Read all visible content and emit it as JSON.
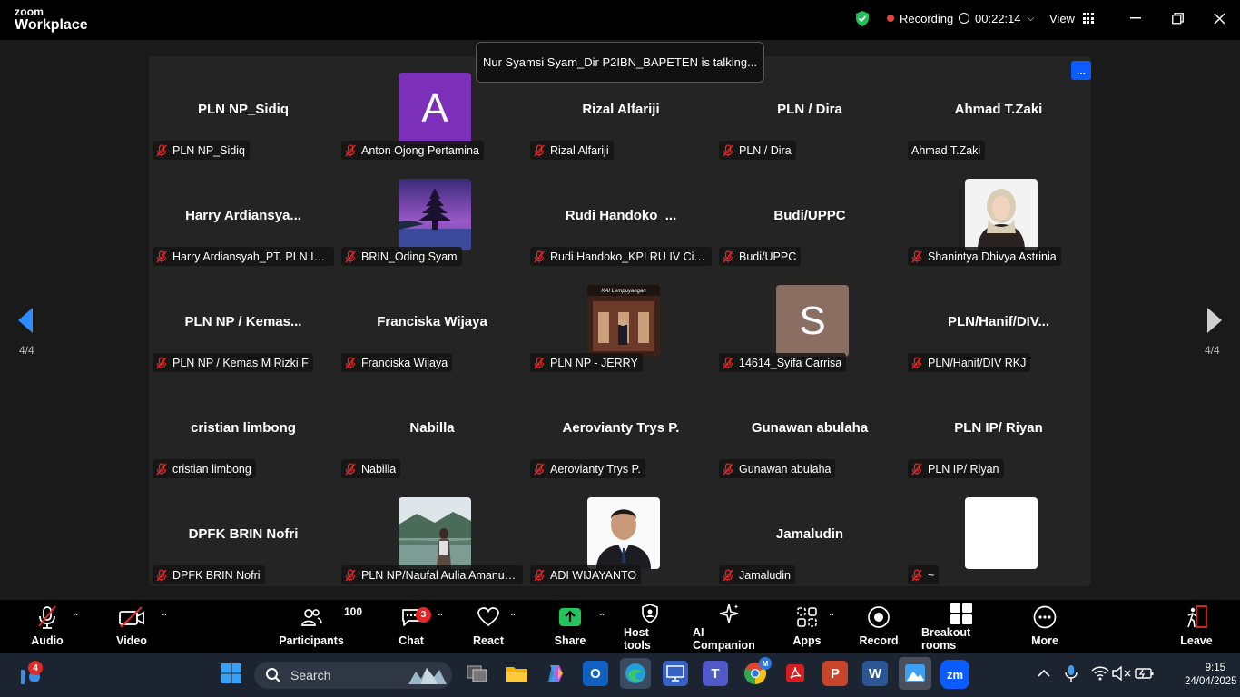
{
  "app": {
    "logo_top": "zoom",
    "logo_bottom": "Workplace"
  },
  "titlebar": {
    "recording_label": "Recording",
    "timer": "00:22:14",
    "view_label": "View"
  },
  "talking_banner": "Nur Syamsi Syam_Dir P2IBN_BAPETEN is talking...",
  "more_button_label": "...",
  "pagination": {
    "left": "4/4",
    "right": "4/4"
  },
  "participants": [
    {
      "display": "PLN NP_Sidiq",
      "label": "PLN NP_Sidiq",
      "muted": true,
      "avatar": "none"
    },
    {
      "display": "",
      "label": "Anton Ojong Pertamina",
      "muted": true,
      "avatar": "letter",
      "letter": "A",
      "color": "#7c2fb8"
    },
    {
      "display": "Rizal Alfariji",
      "label": "Rizal Alfariji",
      "muted": true,
      "avatar": "none"
    },
    {
      "display": "PLN / Dira",
      "label": "PLN / Dira",
      "muted": true,
      "avatar": "none"
    },
    {
      "display": "Ahmad T.Zaki",
      "label": "Ahmad T.Zaki",
      "muted": false,
      "avatar": "none"
    },
    {
      "display": "Harry  Ardiansya...",
      "label": "Harry Ardiansyah_PT. PLN Ind...",
      "muted": true,
      "avatar": "none"
    },
    {
      "display": "",
      "label": "BRIN_Oding Syam",
      "muted": true,
      "avatar": "photo-temple"
    },
    {
      "display": "Rudi  Handoko_...",
      "label": "Rudi Handoko_KPI RU IV Cilac...",
      "muted": true,
      "avatar": "none"
    },
    {
      "display": "Budi/UPPC",
      "label": "Budi/UPPC",
      "muted": true,
      "avatar": "none"
    },
    {
      "display": "",
      "label": "Shanintya Dhivya Astrinia",
      "muted": true,
      "avatar": "photo-hijab"
    },
    {
      "display": "PLN NP / Kemas...",
      "label": "PLN NP / Kemas M Rizki F",
      "muted": true,
      "avatar": "none"
    },
    {
      "display": "Franciska Wijaya",
      "label": "Franciska Wijaya",
      "muted": true,
      "avatar": "none"
    },
    {
      "display": "",
      "label": "PLN NP - JERRY",
      "muted": true,
      "avatar": "photo-station",
      "photo_caption": "KAI Lempuyangan"
    },
    {
      "display": "",
      "label": "14614_Syifa Carrisa",
      "muted": true,
      "avatar": "letter",
      "letter": "S",
      "color": "#8a6e62"
    },
    {
      "display": "PLN/Hanif/DIV...",
      "label": "PLN/Hanif/DIV RKJ",
      "muted": true,
      "avatar": "none"
    },
    {
      "display": "cristian limbong",
      "label": "cristian limbong",
      "muted": true,
      "avatar": "none"
    },
    {
      "display": "Nabilla",
      "label": "Nabilla",
      "muted": true,
      "avatar": "none"
    },
    {
      "display": "Aerovianty Trys P.",
      "label": "Aerovianty Trys P.",
      "muted": true,
      "avatar": "none"
    },
    {
      "display": "Gunawan abulaha",
      "label": "Gunawan abulaha",
      "muted": true,
      "avatar": "none"
    },
    {
      "display": "PLN IP/ Riyan",
      "label": "PLN IP/ Riyan",
      "muted": true,
      "avatar": "none"
    },
    {
      "display": "DPFK BRIN Nofri",
      "label": "DPFK BRIN Nofri",
      "muted": true,
      "avatar": "none"
    },
    {
      "display": "",
      "label": "PLN NP/Naufal Aulia Amanull...",
      "muted": true,
      "avatar": "photo-lake"
    },
    {
      "display": "",
      "label": "ADI WIJAYANTO",
      "muted": true,
      "avatar": "photo-portrait"
    },
    {
      "display": "Jamaludin",
      "label": "Jamaludin",
      "muted": true,
      "avatar": "none"
    },
    {
      "display": "",
      "label": "~",
      "muted": true,
      "avatar": "white"
    }
  ],
  "toolbar": {
    "audio": "Audio",
    "video": "Video",
    "participants": "Participants",
    "participants_count": "100",
    "chat": "Chat",
    "chat_badge": "3",
    "react": "React",
    "share": "Share",
    "host_tools": "Host tools",
    "ai_companion": "AI Companion",
    "apps": "Apps",
    "record": "Record",
    "breakout_rooms": "Breakout rooms",
    "more": "More",
    "leave": "Leave"
  },
  "taskbar": {
    "search_placeholder": "Search",
    "notif_badge": "4",
    "time": "9:15",
    "date": "24/04/2025",
    "zoom_app": "zm",
    "chrome_badge": "M"
  },
  "colors": {
    "accent": "#0b5cff",
    "share_green": "#22c55e",
    "recording_red": "#e5453a",
    "leave_red": "#e02828"
  }
}
